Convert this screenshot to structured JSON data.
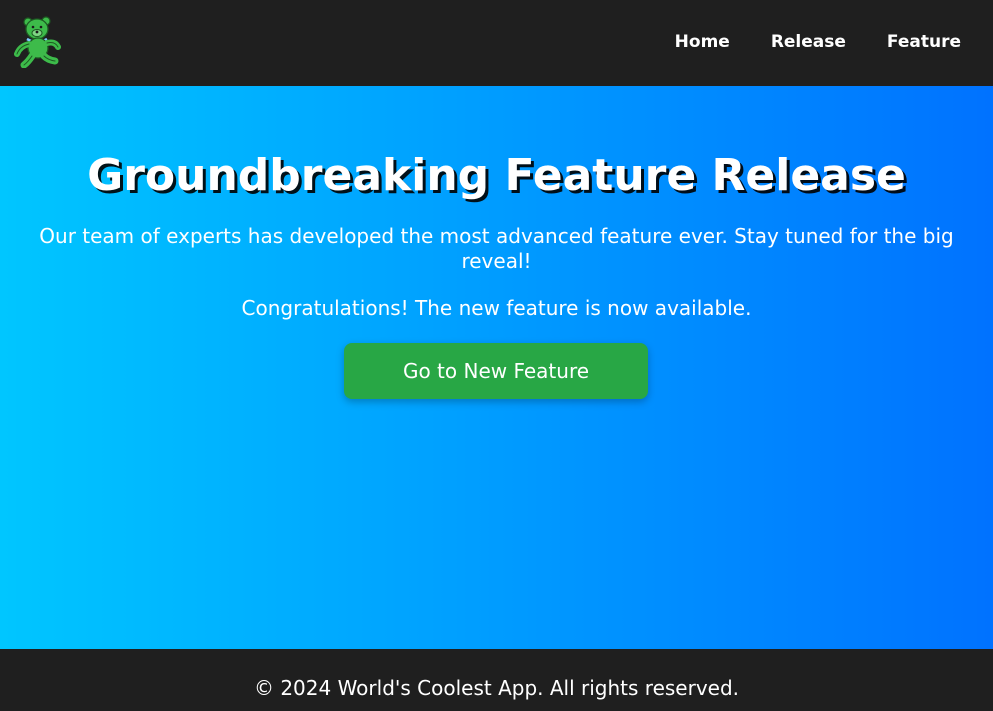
{
  "navbar": {
    "logo_icon": "dancing-bear-logo-icon",
    "links": [
      {
        "label": "Home"
      },
      {
        "label": "Release"
      },
      {
        "label": "Feature"
      }
    ]
  },
  "hero": {
    "title": "Groundbreaking Feature Release",
    "description": "Our team of experts has developed the most advanced feature ever. Stay tuned for the big reveal!",
    "status": "Congratulations! The new feature is now available.",
    "cta_label": "Go to New Feature",
    "gradient_start": "#00c6ff",
    "gradient_end": "#0072ff",
    "cta_color": "#28a745"
  },
  "footer": {
    "text": "© 2024 World's Coolest App. All rights reserved."
  },
  "colors": {
    "navbar_bg": "#1f1f1f",
    "footer_bg": "#1f1f1f",
    "text": "#ffffff"
  }
}
